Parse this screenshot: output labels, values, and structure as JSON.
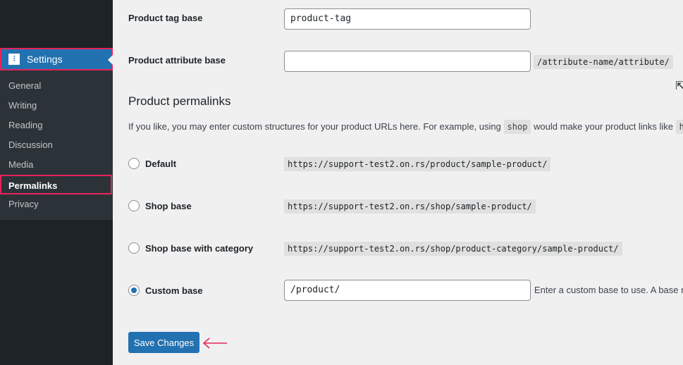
{
  "sidebar": {
    "settings": "Settings",
    "items": [
      "General",
      "Writing",
      "Reading",
      "Discussion",
      "Media",
      "Permalinks",
      "Privacy"
    ]
  },
  "fields": {
    "tag_label": "Product tag base",
    "tag_value": "product-tag",
    "attr_label": "Product attribute base",
    "attr_value": "",
    "attr_hint": "/attribute-name/attribute/"
  },
  "section": {
    "title": "Product permalinks",
    "desc_pre": "If you like, you may enter custom structures for your product URLs here. For example, using",
    "desc_code": "shop",
    "desc_post": "would make your product links like",
    "desc_tail": "h"
  },
  "options": [
    {
      "label": "Default",
      "url": "https://support-test2.on.rs/product/sample-product/"
    },
    {
      "label": "Shop base",
      "url": "https://support-test2.on.rs/shop/sample-product/"
    },
    {
      "label": "Shop base with category",
      "url": "https://support-test2.on.rs/shop/product-category/sample-product/"
    },
    {
      "label": "Custom base",
      "value": "/product/",
      "hint": "Enter a custom base to use. A base m"
    }
  ],
  "selected": "Custom base",
  "save_label": "Save Changes"
}
